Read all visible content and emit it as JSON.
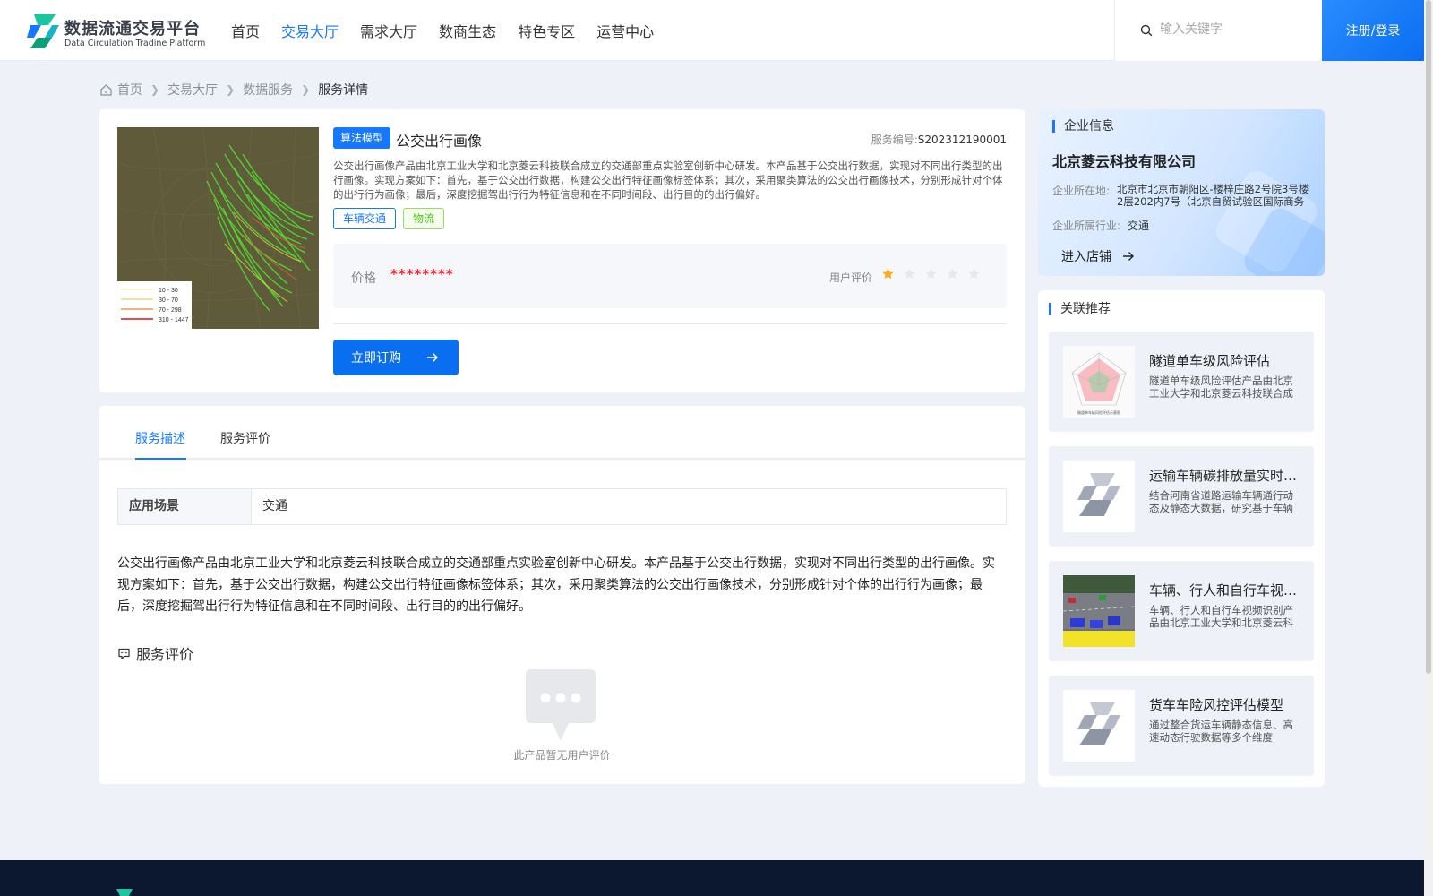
{
  "header": {
    "logo_title": "数据流通交易平台",
    "logo_subtitle": "Data Circulation Tradine Platform",
    "nav": [
      {
        "label": "首页",
        "active": false
      },
      {
        "label": "交易大厅",
        "active": true
      },
      {
        "label": "需求大厅",
        "active": false
      },
      {
        "label": "数商生态",
        "active": false
      },
      {
        "label": "特色专区",
        "active": false
      },
      {
        "label": "运营中心",
        "active": false
      }
    ],
    "search_placeholder": "输入关键字",
    "search_value": "",
    "login_label": "注册/登录"
  },
  "breadcrumb": [
    "首页",
    "交易大厅",
    "数据服务",
    "服务详情"
  ],
  "product": {
    "type_tag": "算法模型",
    "title": "公交出行画像",
    "service_no_label": "服务编号:",
    "service_no": "S202312190001",
    "description": "公交出行画像产品由北京工业大学和北京菱云科技联合成立的交通部重点实验室创新中心研发。本产品基于公交出行数据，实现对不同出行类型的出行画像。实现方案如下：首先，基于公交出行数据，构建公交出行特征画像标签体系；其次，采用聚类算法的公交出行画像技术，分别形成针对个体的出行行为画像；最后，深度挖掘驾出行行为特征信息和在不同时间段、出行目的的出行偏好。",
    "tags": [
      {
        "label": "车辆交通",
        "style": "blue"
      },
      {
        "label": "物流",
        "style": "green"
      }
    ],
    "image_legend": [
      "10 - 30",
      "30 - 70",
      "70 - 298",
      "310 - 1447"
    ],
    "price_label": "价格",
    "price_value": "********",
    "rating_label": "用户评价",
    "rating": 1,
    "rating_max": 5,
    "buy_label": "立即订购"
  },
  "detail": {
    "tabs": [
      {
        "label": "服务描述",
        "active": true
      },
      {
        "label": "服务评价",
        "active": false
      }
    ],
    "scene_label": "应用场景",
    "scene_value": "交通",
    "long_description": "公交出行画像产品由北京工业大学和北京菱云科技联合成立的交通部重点实验室创新中心研发。本产品基于公交出行数据，实现对不同出行类型的出行画像。实现方案如下：首先，基于公交出行数据，构建公交出行特征画像标签体系；其次，采用聚类算法的公交出行画像技术，分别形成针对个体的出行行为画像；最后，深度挖掘驾出行行为特征信息和在不同时间段、出行目的的出行偏好。",
    "review_title": "服务评价",
    "empty_text": "此产品暂无用户评价"
  },
  "company": {
    "section_title": "企业信息",
    "name": "北京菱云科技有限公司",
    "location_label": "企业所在地:",
    "location": "北京市北京市朝阳区-楼梓庄路2号院3号楼2层202内7号（北京自贸试验区国际商务服务片区）",
    "industry_label": "企业所属行业:",
    "industry": "交通",
    "enter_label": "进入店铺"
  },
  "related": {
    "section_title": "关联推荐",
    "items": [
      {
        "name": "隧道单车级风险评估",
        "desc": "隧道单车级风险评估产品由北京工业大学和北京菱云科技联合成立的交通部重点实验室",
        "thumb": "radar-chart",
        "thumb_caption": "隧道单车级风险评估示意图"
      },
      {
        "name": "运输车辆碳排放量实时监测",
        "desc": "结合河南省道路运输车辆通行动态及静态大数据，研究基于车辆行驶轨迹的碳排放",
        "thumb": "logo-placeholder"
      },
      {
        "name": "车辆、行人和自行车视频识别",
        "desc": "车辆、行人和自行车视频识别产品由北京工业大学和北京菱云科技联合成立",
        "thumb": "road-scene"
      },
      {
        "name": "货车车险风控评估模型",
        "desc": "通过整合货运车辆静态信息、高速动态行驶数据等多个维度",
        "thumb": "logo-placeholder"
      }
    ]
  },
  "colors": {
    "primary": "#1677ff",
    "price": "#f5222d",
    "star_on": "#faad14",
    "star_off": "#e6e8ec",
    "footer": "#0c1730"
  }
}
